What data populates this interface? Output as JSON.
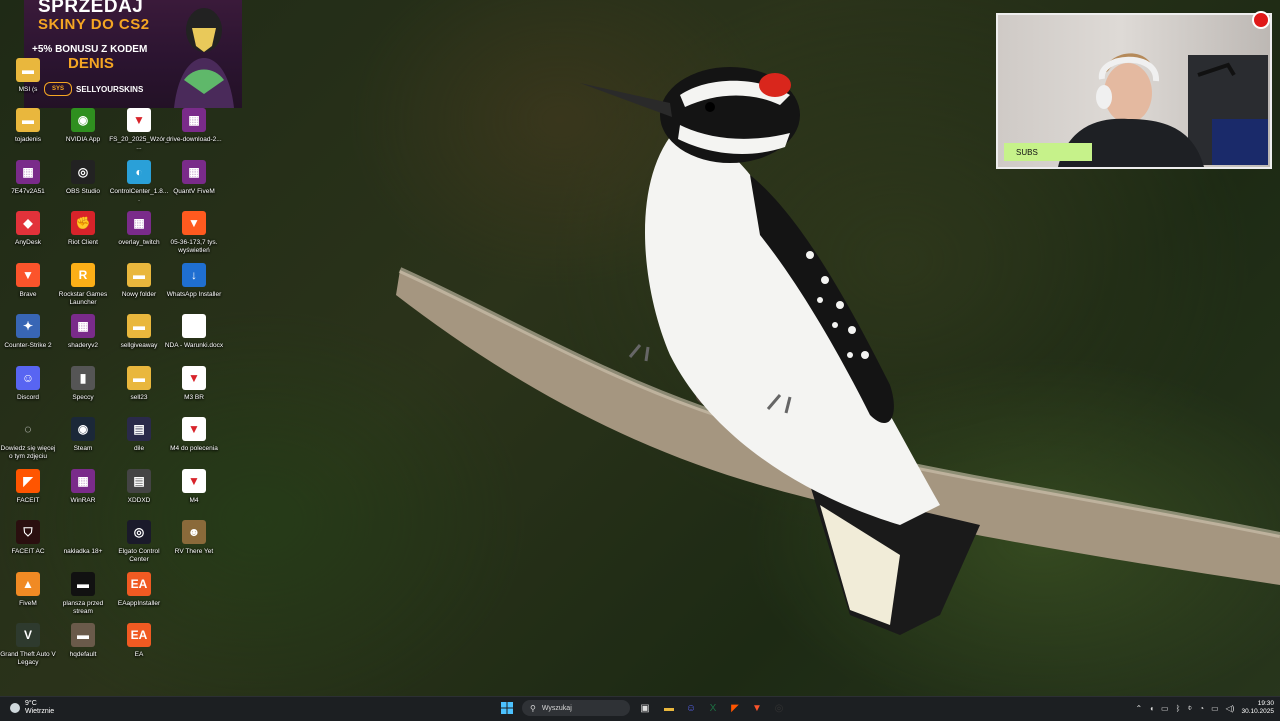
{
  "promo": {
    "line1": "SPRZEDAJ",
    "line2": "SKINY DO CS2",
    "line3": "+5% BONUSU Z KODEM",
    "line4": "DENIS",
    "brand": "SELLYOURSKINS",
    "brand_badge": "SYS"
  },
  "partial_icon_label": "MSI (s",
  "icons": [
    {
      "label": "tojadenis",
      "color": "#e9b73d",
      "glyph": "▬"
    },
    {
      "label": "NVIDIA App",
      "color": "#2f8f1f",
      "glyph": "◉"
    },
    {
      "label": "FS_20_2025_Wzór_...",
      "color": "#ffffff",
      "glyph": "▼"
    },
    {
      "label": "drive-download-2...",
      "color": "#7a2b8a",
      "glyph": "▦"
    },
    {
      "label": "7E47v2A51",
      "color": "#7a2b8a",
      "glyph": "▦"
    },
    {
      "label": "OBS Studio",
      "color": "#222222",
      "glyph": "◎"
    },
    {
      "label": "ControlCenter_1.8....",
      "color": "#2aa0d8",
      "glyph": "◐"
    },
    {
      "label": "QuantV FiveM",
      "color": "#7a2b8a",
      "glyph": "▦"
    },
    {
      "label": "AnyDesk",
      "color": "#e2323a",
      "glyph": "◆"
    },
    {
      "label": "Riot Client",
      "color": "#d8232a",
      "glyph": "✊"
    },
    {
      "label": "overlay_twitch",
      "color": "#7a2b8a",
      "glyph": "▦"
    },
    {
      "label": "05-36-173,7 tys. wyświetleń",
      "color": "#ff5a1f",
      "glyph": "▼"
    },
    {
      "label": "Brave",
      "color": "#fb542b",
      "glyph": "▼"
    },
    {
      "label": "Rockstar Games Launcher",
      "color": "#fcaf17",
      "glyph": "R"
    },
    {
      "label": "Nowy folder",
      "color": "#e9b73d",
      "glyph": "▬"
    },
    {
      "label": "WhatsApp Installer",
      "color": "#1f6fd1",
      "glyph": "↓"
    },
    {
      "label": "Counter-Strike 2",
      "color": "#3866b5",
      "glyph": "✦"
    },
    {
      "label": "shaderyv2",
      "color": "#7a2b8a",
      "glyph": "▦"
    },
    {
      "label": "sellgiveaway",
      "color": "#e9b73d",
      "glyph": "▬"
    },
    {
      "label": "NDA - Warunki.docx",
      "color": "#ffffff",
      "glyph": ""
    },
    {
      "label": "Discord",
      "color": "#5865f2",
      "glyph": "☺"
    },
    {
      "label": "Speccy",
      "color": "#555555",
      "glyph": "▮"
    },
    {
      "label": "sell23",
      "color": "#e9b73d",
      "glyph": "▬"
    },
    {
      "label": "M3 BR",
      "color": "#ffffff",
      "glyph": "▼"
    },
    {
      "label": "Dowiedz się więcej o tym zdjęciu",
      "color": "transparent",
      "glyph": "◌"
    },
    {
      "label": "Steam",
      "color": "#1b2838",
      "glyph": "◉"
    },
    {
      "label": "dile",
      "color": "#2a2a4a",
      "glyph": "▤"
    },
    {
      "label": "M4 do polecenia",
      "color": "#ffffff",
      "glyph": "▼"
    },
    {
      "label": "FACEIT",
      "color": "#ff5500",
      "glyph": "◤"
    },
    {
      "label": "WinRAR",
      "color": "#7a2b8a",
      "glyph": "▦"
    },
    {
      "label": "XDDXD",
      "color": "#444444",
      "glyph": "▤"
    },
    {
      "label": "M4",
      "color": "#ffffff",
      "glyph": "▼"
    },
    {
      "label": "FACEIT AC",
      "color": "#2a0f0f",
      "glyph": "⛉"
    },
    {
      "label": "nakładka 18+",
      "color": "transparent",
      "glyph": ""
    },
    {
      "label": "Elgato Control Center",
      "color": "#1a1a2a",
      "glyph": "◎"
    },
    {
      "label": "RV There Yet",
      "color": "#8a6a3a",
      "glyph": "☻"
    },
    {
      "label": "FiveM",
      "color": "#f08a24",
      "glyph": "▲"
    },
    {
      "label": "plansza przed stream",
      "color": "#111111",
      "glyph": "▬"
    },
    {
      "label": "EAappInstaller",
      "color": "#f05a22",
      "glyph": "EA"
    },
    {
      "label": "",
      "color": "transparent",
      "glyph": ""
    },
    {
      "label": "Grand Theft Auto V Legacy",
      "color": "#2e3a2e",
      "glyph": "V"
    },
    {
      "label": "hqdefault",
      "color": "#6a5a4a",
      "glyph": "▬"
    },
    {
      "label": "EA",
      "color": "#f05a22",
      "glyph": "EA"
    },
    {
      "label": "",
      "color": "transparent",
      "glyph": ""
    }
  ],
  "webcam": {
    "subs_label": "SUBS"
  },
  "taskbar": {
    "temperature": "9°C",
    "weather_text": "Wietrznie",
    "search_placeholder": "Wyszukaj",
    "time": "19:30",
    "date": "30.10.2025",
    "apps": [
      {
        "name": "file-explorer-icon",
        "glyph": "▬",
        "color": "#e9b73d"
      },
      {
        "name": "discord-icon",
        "glyph": "☺",
        "color": "#5865f2"
      },
      {
        "name": "excel-icon",
        "glyph": "X",
        "color": "#1d6f42"
      },
      {
        "name": "faceit-icon",
        "glyph": "◤",
        "color": "#ff5500"
      },
      {
        "name": "brave-icon",
        "glyph": "▼",
        "color": "#fb542b"
      },
      {
        "name": "obs-icon",
        "glyph": "◎",
        "color": "#333333"
      }
    ]
  }
}
